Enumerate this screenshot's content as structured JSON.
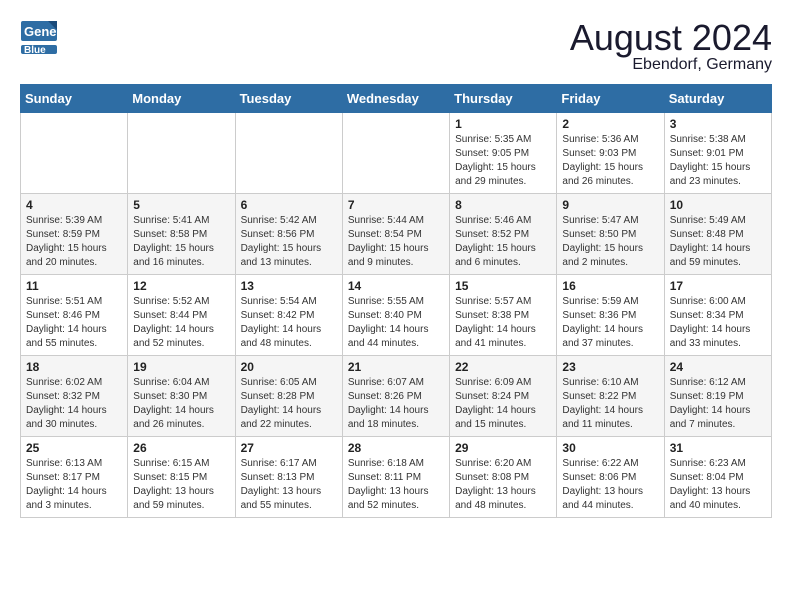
{
  "header": {
    "logo_line1": "General",
    "logo_line2": "Blue",
    "month_year": "August 2024",
    "location": "Ebendorf, Germany"
  },
  "weekdays": [
    "Sunday",
    "Monday",
    "Tuesday",
    "Wednesday",
    "Thursday",
    "Friday",
    "Saturday"
  ],
  "weeks": [
    [
      {
        "day": "",
        "info": ""
      },
      {
        "day": "",
        "info": ""
      },
      {
        "day": "",
        "info": ""
      },
      {
        "day": "",
        "info": ""
      },
      {
        "day": "1",
        "info": "Sunrise: 5:35 AM\nSunset: 9:05 PM\nDaylight: 15 hours\nand 29 minutes."
      },
      {
        "day": "2",
        "info": "Sunrise: 5:36 AM\nSunset: 9:03 PM\nDaylight: 15 hours\nand 26 minutes."
      },
      {
        "day": "3",
        "info": "Sunrise: 5:38 AM\nSunset: 9:01 PM\nDaylight: 15 hours\nand 23 minutes."
      }
    ],
    [
      {
        "day": "4",
        "info": "Sunrise: 5:39 AM\nSunset: 8:59 PM\nDaylight: 15 hours\nand 20 minutes."
      },
      {
        "day": "5",
        "info": "Sunrise: 5:41 AM\nSunset: 8:58 PM\nDaylight: 15 hours\nand 16 minutes."
      },
      {
        "day": "6",
        "info": "Sunrise: 5:42 AM\nSunset: 8:56 PM\nDaylight: 15 hours\nand 13 minutes."
      },
      {
        "day": "7",
        "info": "Sunrise: 5:44 AM\nSunset: 8:54 PM\nDaylight: 15 hours\nand 9 minutes."
      },
      {
        "day": "8",
        "info": "Sunrise: 5:46 AM\nSunset: 8:52 PM\nDaylight: 15 hours\nand 6 minutes."
      },
      {
        "day": "9",
        "info": "Sunrise: 5:47 AM\nSunset: 8:50 PM\nDaylight: 15 hours\nand 2 minutes."
      },
      {
        "day": "10",
        "info": "Sunrise: 5:49 AM\nSunset: 8:48 PM\nDaylight: 14 hours\nand 59 minutes."
      }
    ],
    [
      {
        "day": "11",
        "info": "Sunrise: 5:51 AM\nSunset: 8:46 PM\nDaylight: 14 hours\nand 55 minutes."
      },
      {
        "day": "12",
        "info": "Sunrise: 5:52 AM\nSunset: 8:44 PM\nDaylight: 14 hours\nand 52 minutes."
      },
      {
        "day": "13",
        "info": "Sunrise: 5:54 AM\nSunset: 8:42 PM\nDaylight: 14 hours\nand 48 minutes."
      },
      {
        "day": "14",
        "info": "Sunrise: 5:55 AM\nSunset: 8:40 PM\nDaylight: 14 hours\nand 44 minutes."
      },
      {
        "day": "15",
        "info": "Sunrise: 5:57 AM\nSunset: 8:38 PM\nDaylight: 14 hours\nand 41 minutes."
      },
      {
        "day": "16",
        "info": "Sunrise: 5:59 AM\nSunset: 8:36 PM\nDaylight: 14 hours\nand 37 minutes."
      },
      {
        "day": "17",
        "info": "Sunrise: 6:00 AM\nSunset: 8:34 PM\nDaylight: 14 hours\nand 33 minutes."
      }
    ],
    [
      {
        "day": "18",
        "info": "Sunrise: 6:02 AM\nSunset: 8:32 PM\nDaylight: 14 hours\nand 30 minutes."
      },
      {
        "day": "19",
        "info": "Sunrise: 6:04 AM\nSunset: 8:30 PM\nDaylight: 14 hours\nand 26 minutes."
      },
      {
        "day": "20",
        "info": "Sunrise: 6:05 AM\nSunset: 8:28 PM\nDaylight: 14 hours\nand 22 minutes."
      },
      {
        "day": "21",
        "info": "Sunrise: 6:07 AM\nSunset: 8:26 PM\nDaylight: 14 hours\nand 18 minutes."
      },
      {
        "day": "22",
        "info": "Sunrise: 6:09 AM\nSunset: 8:24 PM\nDaylight: 14 hours\nand 15 minutes."
      },
      {
        "day": "23",
        "info": "Sunrise: 6:10 AM\nSunset: 8:22 PM\nDaylight: 14 hours\nand 11 minutes."
      },
      {
        "day": "24",
        "info": "Sunrise: 6:12 AM\nSunset: 8:19 PM\nDaylight: 14 hours\nand 7 minutes."
      }
    ],
    [
      {
        "day": "25",
        "info": "Sunrise: 6:13 AM\nSunset: 8:17 PM\nDaylight: 14 hours\nand 3 minutes."
      },
      {
        "day": "26",
        "info": "Sunrise: 6:15 AM\nSunset: 8:15 PM\nDaylight: 13 hours\nand 59 minutes."
      },
      {
        "day": "27",
        "info": "Sunrise: 6:17 AM\nSunset: 8:13 PM\nDaylight: 13 hours\nand 55 minutes."
      },
      {
        "day": "28",
        "info": "Sunrise: 6:18 AM\nSunset: 8:11 PM\nDaylight: 13 hours\nand 52 minutes."
      },
      {
        "day": "29",
        "info": "Sunrise: 6:20 AM\nSunset: 8:08 PM\nDaylight: 13 hours\nand 48 minutes."
      },
      {
        "day": "30",
        "info": "Sunrise: 6:22 AM\nSunset: 8:06 PM\nDaylight: 13 hours\nand 44 minutes."
      },
      {
        "day": "31",
        "info": "Sunrise: 6:23 AM\nSunset: 8:04 PM\nDaylight: 13 hours\nand 40 minutes."
      }
    ]
  ]
}
